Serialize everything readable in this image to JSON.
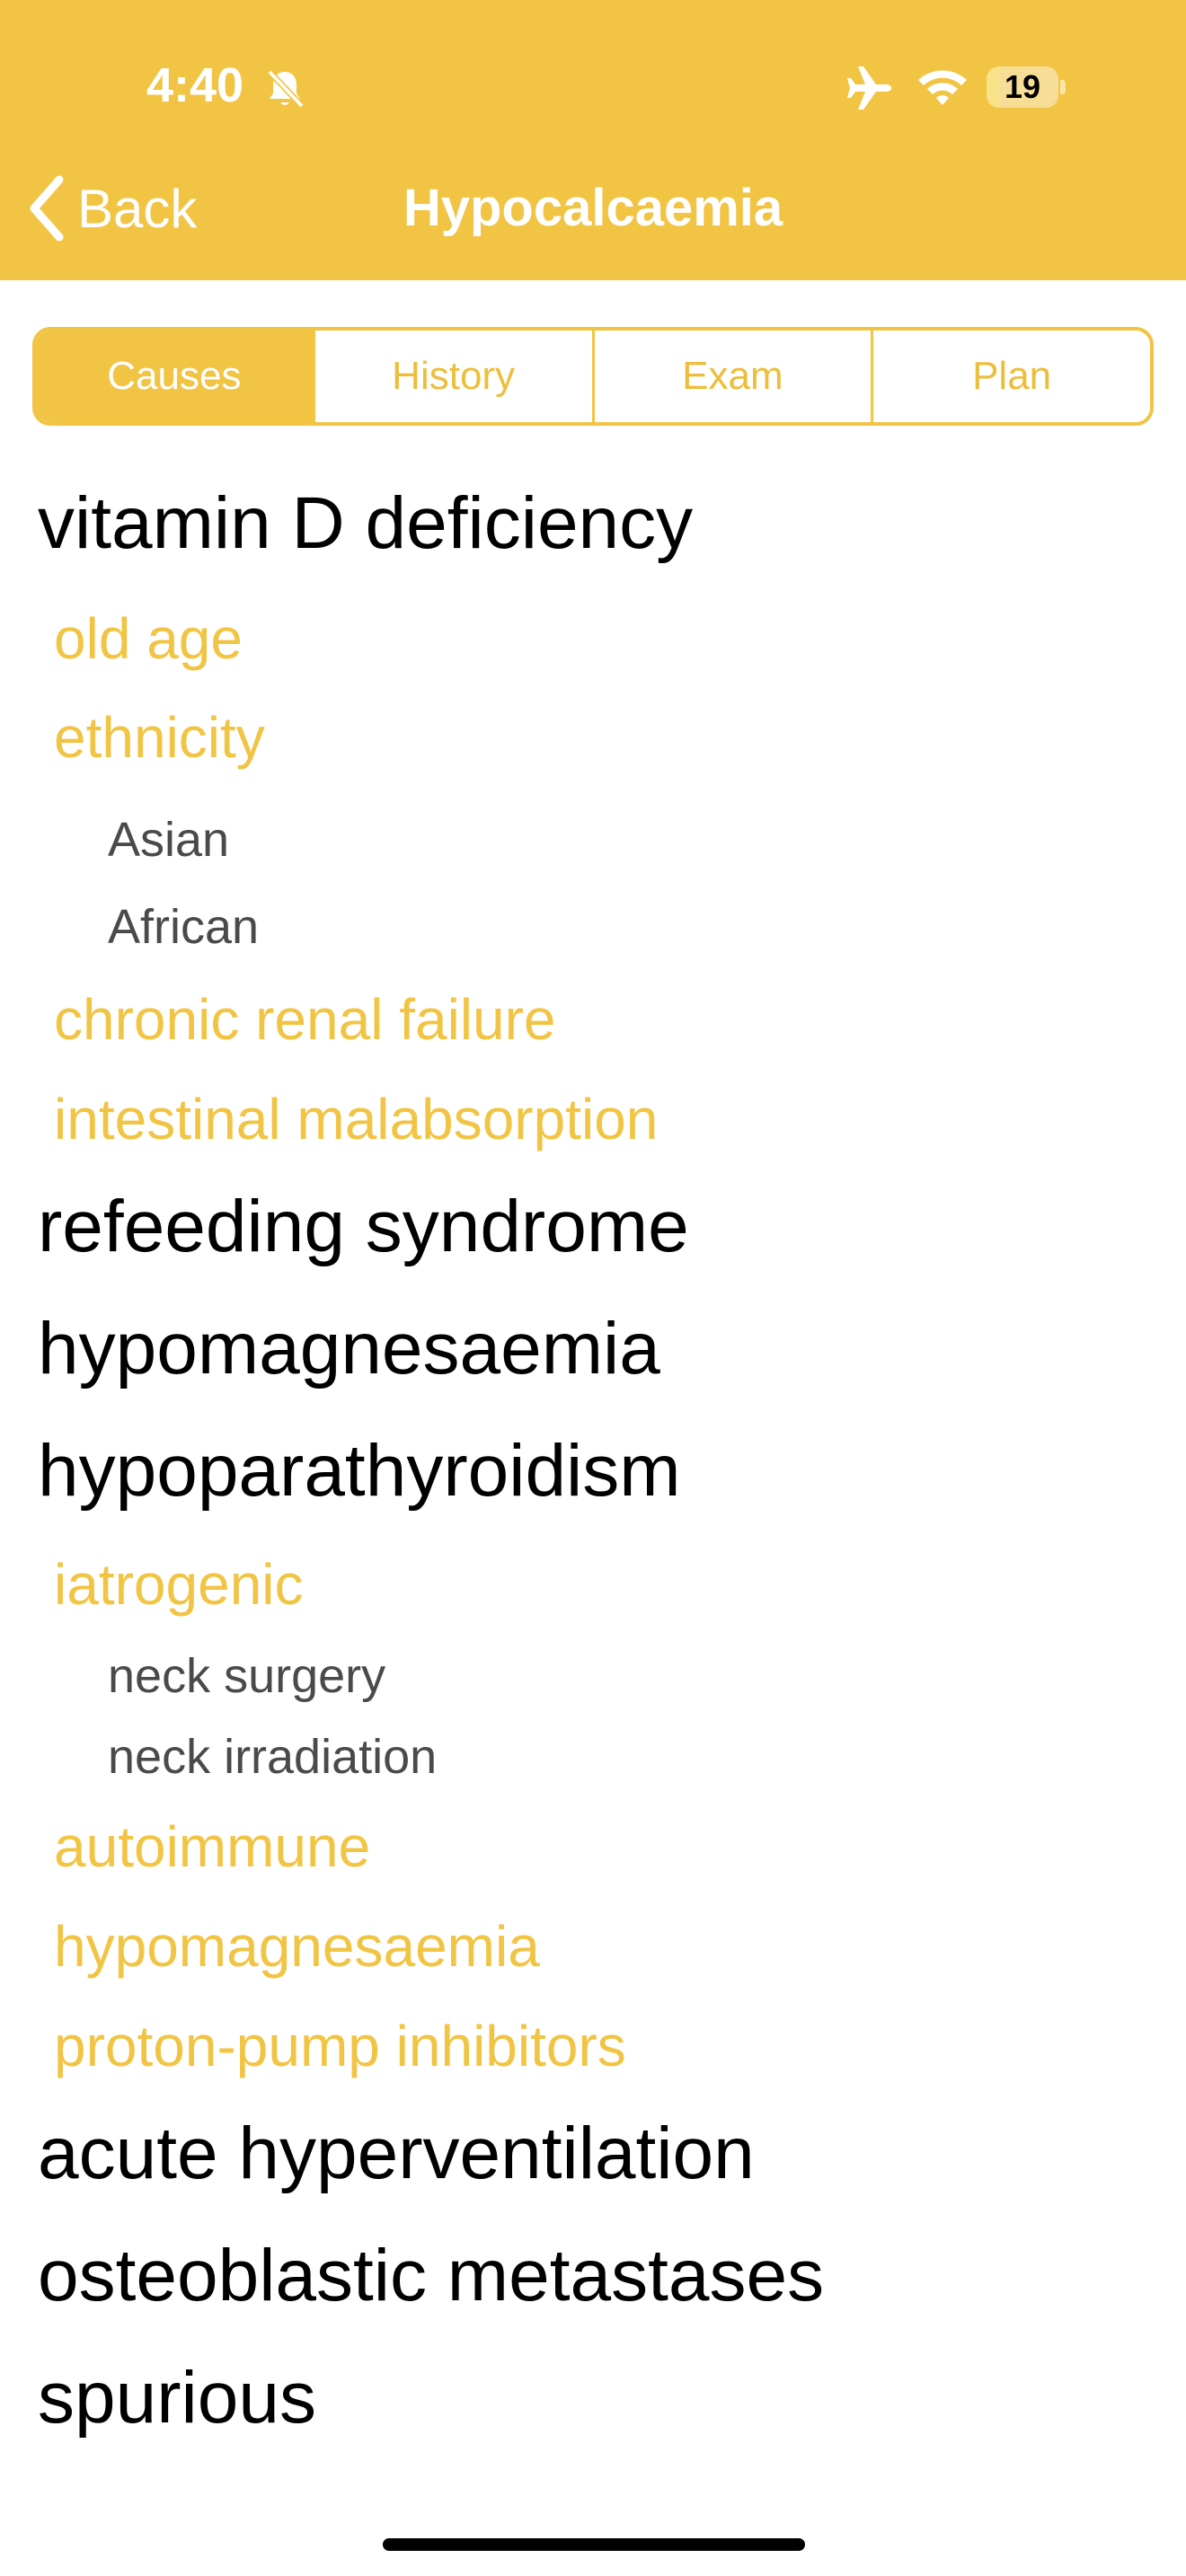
{
  "status_bar": {
    "time": "4:40",
    "battery": "19",
    "battery_level": 0.19,
    "icons": [
      "bell-slash-icon",
      "airplane-icon",
      "wifi-icon",
      "battery-icon"
    ]
  },
  "nav": {
    "back_label": "Back",
    "title": "Hypocalcaemia"
  },
  "tabs": [
    {
      "label": "Causes",
      "active": true
    },
    {
      "label": "History",
      "active": false
    },
    {
      "label": "Exam",
      "active": false
    },
    {
      "label": "Plan",
      "active": false
    }
  ],
  "causes": [
    {
      "text": "vitamin D deficiency",
      "level": 0
    },
    {
      "text": "old age",
      "level": 1
    },
    {
      "text": "ethnicity",
      "level": 1
    },
    {
      "text": "Asian",
      "level": 2
    },
    {
      "text": "African",
      "level": 2
    },
    {
      "text": "chronic renal failure",
      "level": 1
    },
    {
      "text": "intestinal malabsorption",
      "level": 1
    },
    {
      "text": "refeeding syndrome",
      "level": 0
    },
    {
      "text": "hypomagnesaemia",
      "level": 0
    },
    {
      "text": "hypoparathyroidism",
      "level": 0
    },
    {
      "text": "iatrogenic",
      "level": 1
    },
    {
      "text": "neck surgery",
      "level": 2
    },
    {
      "text": "neck irradiation",
      "level": 2
    },
    {
      "text": "autoimmune",
      "level": 1
    },
    {
      "text": "hypomagnesaemia",
      "level": 1
    },
    {
      "text": "proton-pump inhibitors",
      "level": 1
    },
    {
      "text": "acute hyperventilation",
      "level": 0
    },
    {
      "text": "osteoblastic metastases",
      "level": 0
    },
    {
      "text": "spurious",
      "level": 0
    }
  ],
  "colors": {
    "accent": "#F1C443",
    "text_primary": "#000000",
    "text_secondary": "#4a4a4a"
  }
}
